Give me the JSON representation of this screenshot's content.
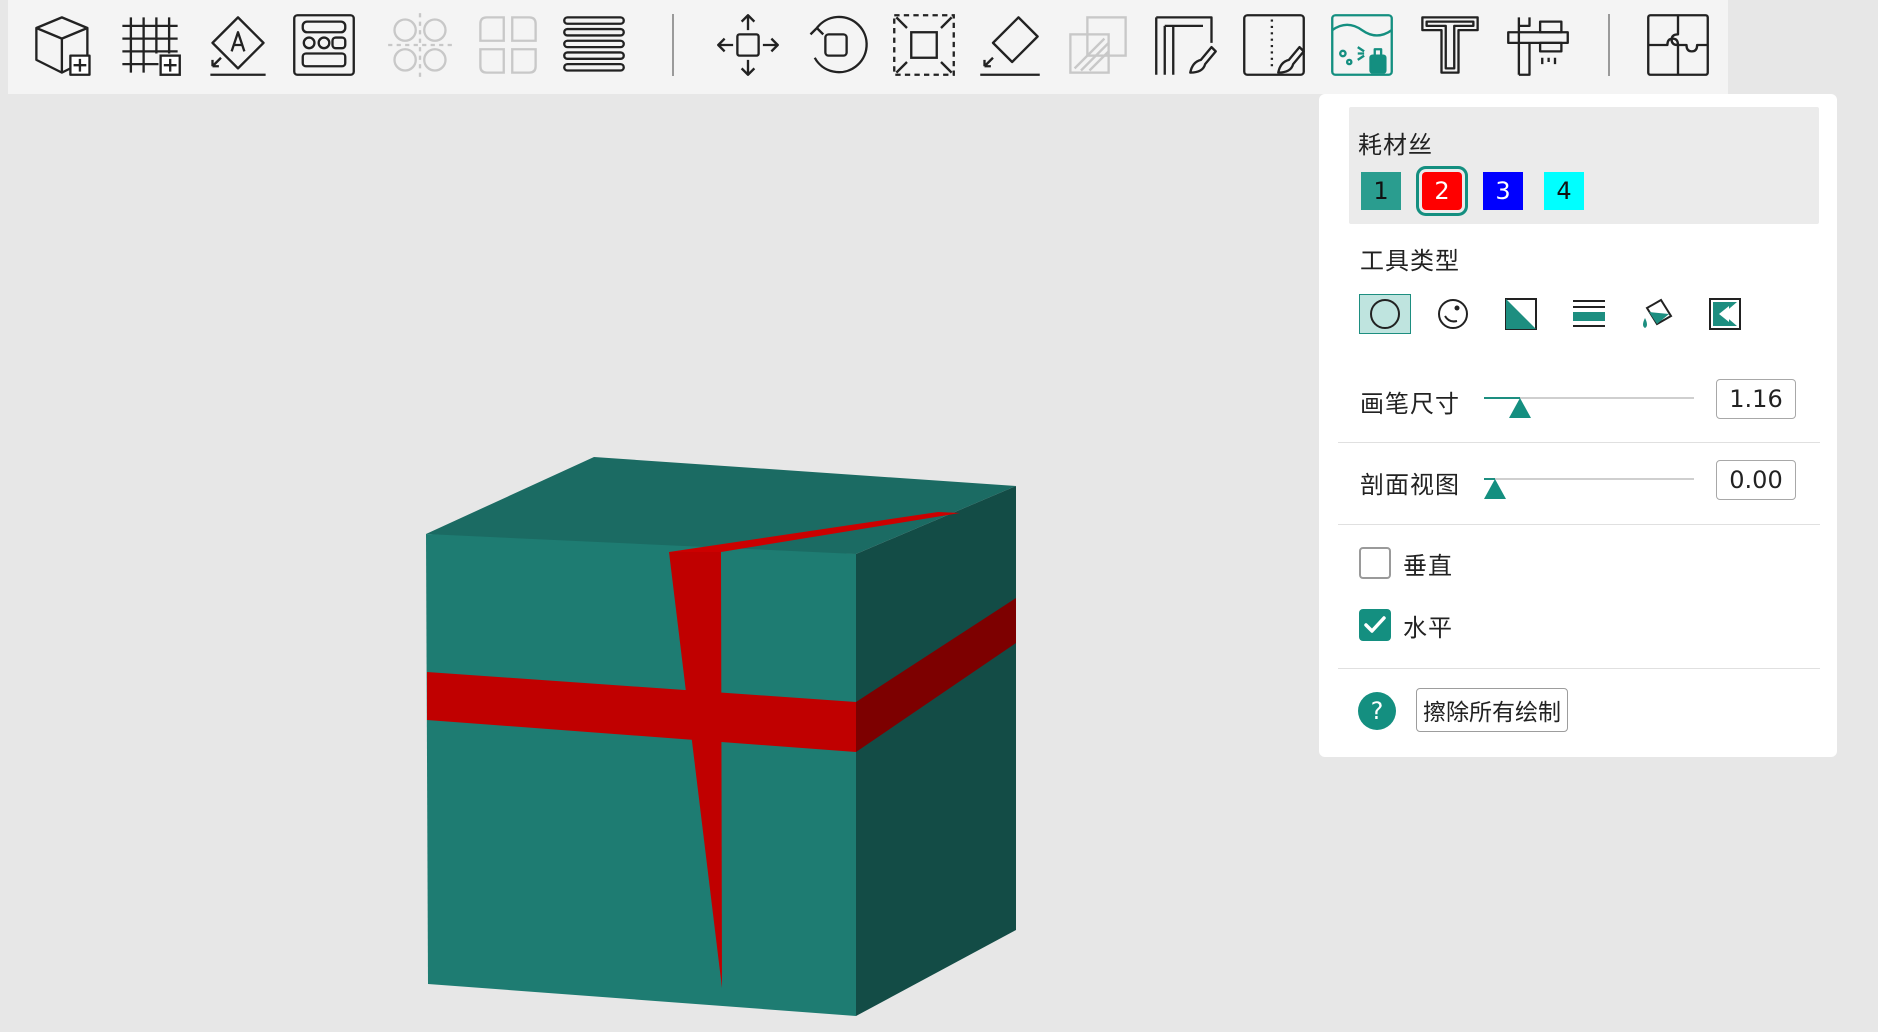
{
  "toolbar": {
    "tools": [
      {
        "name": "add-object-icon",
        "enabled": true
      },
      {
        "name": "add-plate-icon",
        "enabled": true
      },
      {
        "name": "auto-orient-icon",
        "enabled": true
      },
      {
        "name": "arrange-icon",
        "enabled": true
      },
      {
        "name": "split-objects-icon",
        "enabled": false
      },
      {
        "name": "split-parts-icon",
        "enabled": false
      },
      {
        "name": "layer-editing-icon",
        "enabled": true
      },
      {
        "name": "move-icon",
        "enabled": true
      },
      {
        "name": "rotate-icon",
        "enabled": true
      },
      {
        "name": "scale-icon",
        "enabled": true
      },
      {
        "name": "lay-on-face-icon",
        "enabled": true
      },
      {
        "name": "cut-icon",
        "enabled": false
      },
      {
        "name": "support-painting-icon",
        "enabled": true
      },
      {
        "name": "seam-painting-icon",
        "enabled": true
      },
      {
        "name": "color-painting-icon",
        "enabled": true,
        "active": true
      },
      {
        "name": "text-icon",
        "enabled": true
      },
      {
        "name": "measure-icon",
        "enabled": true
      },
      {
        "name": "assembly-icon",
        "enabled": true
      }
    ]
  },
  "model": {
    "base_color": "#1e7c72",
    "paint_color": "#cc0000"
  },
  "panel": {
    "filament_title": "耗材丝",
    "filaments": [
      {
        "label": "1",
        "color": "#2a9d8f",
        "text_color": "#111111",
        "selected": false
      },
      {
        "label": "2",
        "color": "#ff0000",
        "text_color": "#ffffff",
        "selected": true
      },
      {
        "label": "3",
        "color": "#0000ff",
        "text_color": "#ffffff",
        "selected": false
      },
      {
        "label": "4",
        "color": "#00ffff",
        "text_color": "#111111",
        "selected": false
      }
    ],
    "tool_type_title": "工具类型",
    "tools": [
      {
        "name": "circle-brush-icon",
        "selected": true
      },
      {
        "name": "sphere-brush-icon",
        "selected": false
      },
      {
        "name": "triangle-brush-icon",
        "selected": false
      },
      {
        "name": "height-range-icon",
        "selected": false
      },
      {
        "name": "fill-bucket-icon",
        "selected": false
      },
      {
        "name": "gap-fill-icon",
        "selected": false
      }
    ],
    "brush_size_label": "画笔尺寸",
    "brush_size_value": "1.16",
    "brush_size_fraction": 0.17,
    "section_view_label": "剖面视图",
    "section_view_value": "0.00",
    "section_view_fraction": 0.05,
    "vertical_label": "垂直",
    "vertical_checked": false,
    "horizontal_label": "水平",
    "horizontal_checked": true,
    "erase_all_label": "擦除所有绘制",
    "help_symbol": "?"
  }
}
